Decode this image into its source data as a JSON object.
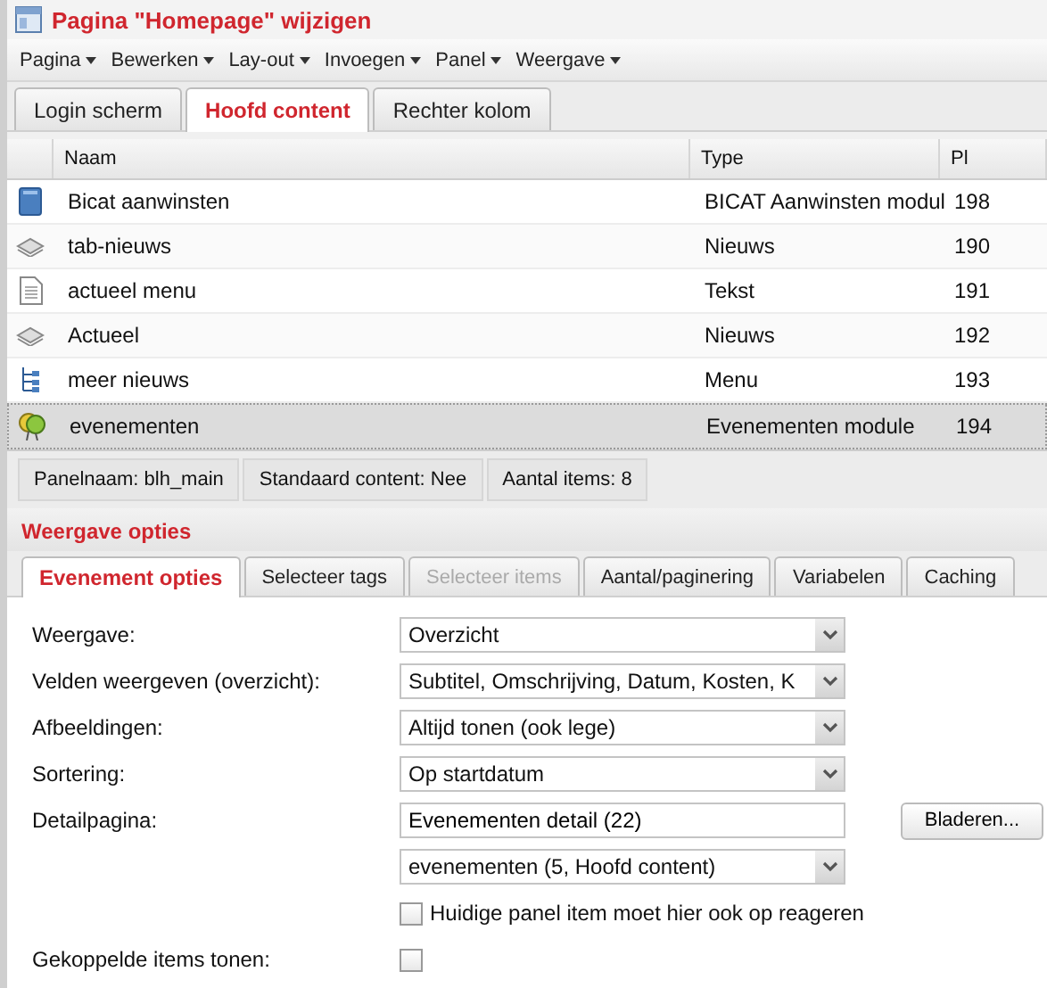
{
  "window": {
    "title": "Pagina \"Homepage\" wijzigen"
  },
  "menu": [
    "Pagina",
    "Bewerken",
    "Lay-out",
    "Invoegen",
    "Panel",
    "Weergave"
  ],
  "panel_tabs": [
    {
      "label": "Login scherm",
      "selected": false
    },
    {
      "label": "Hoofd content",
      "selected": true
    },
    {
      "label": "Rechter kolom",
      "selected": false
    }
  ],
  "table": {
    "columns": [
      "Naam",
      "Type",
      "Pl"
    ],
    "rows": [
      {
        "kind": "book",
        "name": "Bicat aanwinsten",
        "type": "BICAT Aanwinsten modul",
        "pl": "198",
        "selected": false
      },
      {
        "kind": "stack",
        "name": "tab-nieuws",
        "type": "Nieuws",
        "pl": "190",
        "selected": false
      },
      {
        "kind": "document",
        "name": "actueel menu",
        "type": "Tekst",
        "pl": "191",
        "selected": false
      },
      {
        "kind": "stack",
        "name": "Actueel",
        "type": "Nieuws",
        "pl": "192",
        "selected": false
      },
      {
        "kind": "tree",
        "name": "meer nieuws",
        "type": "Menu",
        "pl": "193",
        "selected": false
      },
      {
        "kind": "balloon",
        "name": "evenementen",
        "type": "Evenementen module",
        "pl": "194",
        "selected": true
      }
    ]
  },
  "status_bar": [
    "Panelnaam: blh_main",
    "Standaard content: Nee",
    "Aantal items: 8"
  ],
  "options": {
    "title": "Weergave opties",
    "tabs": [
      {
        "label": "Evenement opties",
        "selected": true,
        "disabled": false
      },
      {
        "label": "Selecteer tags",
        "selected": false,
        "disabled": false
      },
      {
        "label": "Selecteer items",
        "selected": false,
        "disabled": true
      },
      {
        "label": "Aantal/paginering",
        "selected": false,
        "disabled": false
      },
      {
        "label": "Variabelen",
        "selected": false,
        "disabled": false
      },
      {
        "label": "Caching",
        "selected": false,
        "disabled": false
      }
    ],
    "fields": [
      {
        "kind": "select",
        "label": "Weergave:",
        "value": "Overzicht"
      },
      {
        "kind": "select",
        "label": "Velden weergeven (overzicht):",
        "value": "Subtitel, Omschrijving, Datum, Kosten, K"
      },
      {
        "kind": "select",
        "label": "Afbeeldingen:",
        "value": "Altijd tonen (ook lege)"
      },
      {
        "kind": "select",
        "label": "Sortering:",
        "value": "Op startdatum"
      },
      {
        "kind": "input",
        "label": "Detailpagina:",
        "value": "Evenementen detail (22)",
        "button": "Bladeren..."
      },
      {
        "kind": "select",
        "value": "evenementen (5, Hoofd content)"
      },
      {
        "kind": "checkbox",
        "text": "Huidige panel item moet hier ook op reageren",
        "checked": false
      },
      {
        "kind": "checkbox",
        "label": "Gekoppelde items tonen:",
        "checked": false
      }
    ]
  }
}
